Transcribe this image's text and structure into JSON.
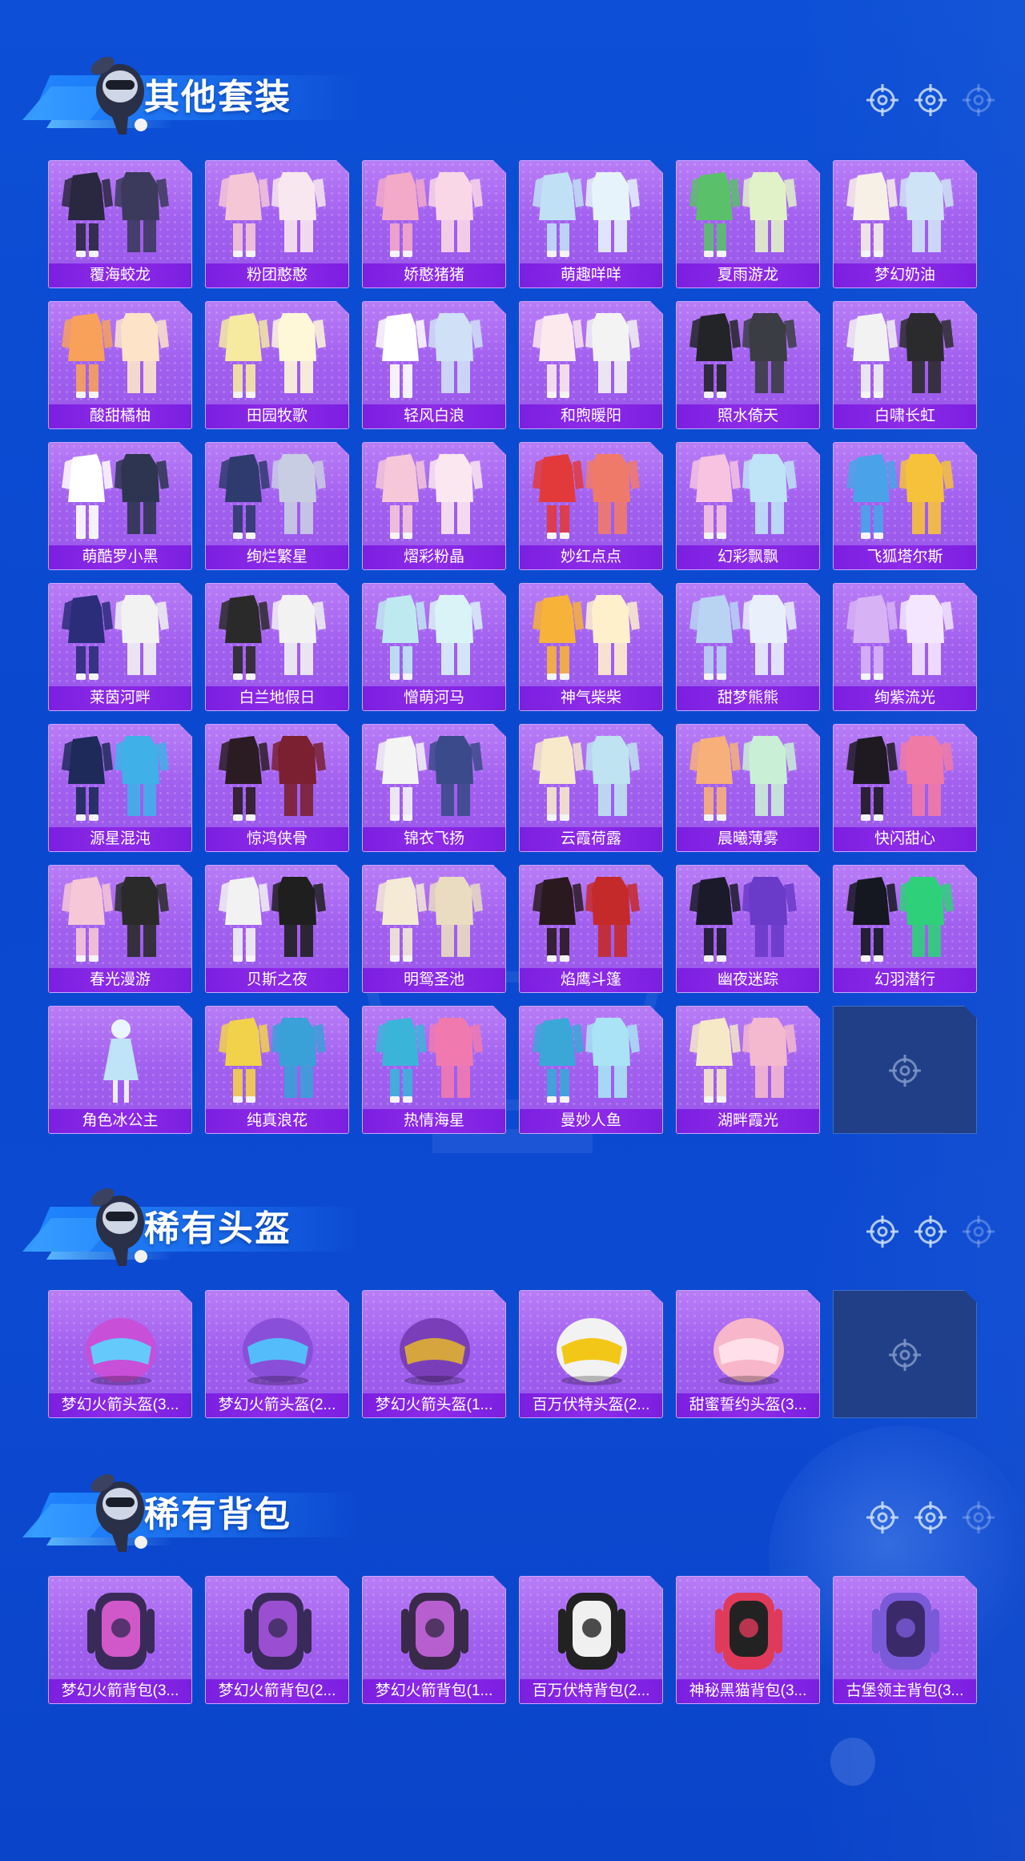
{
  "sections": [
    {
      "title": "其他套装",
      "items": [
        {
          "label": "覆海蛟龙",
          "icon": "outfit-icon",
          "palette": [
            "#2a2740",
            "#3b3a5c"
          ]
        },
        {
          "label": "粉团憨憨",
          "icon": "outfit-icon",
          "palette": [
            "#f5c6d6",
            "#f8e7ee"
          ]
        },
        {
          "label": "娇憨猪猪",
          "icon": "outfit-icon",
          "palette": [
            "#f3a9c8",
            "#f9d7e6"
          ]
        },
        {
          "label": "萌趣咩咩",
          "icon": "outfit-icon",
          "palette": [
            "#bfe0f5",
            "#e6f3fb"
          ]
        },
        {
          "label": "夏雨游龙",
          "icon": "outfit-icon",
          "palette": [
            "#5bc06a",
            "#e2f2c8"
          ]
        },
        {
          "label": "梦幻奶油",
          "icon": "outfit-icon",
          "palette": [
            "#f7f0e6",
            "#cfe3f6"
          ]
        },
        {
          "label": "酸甜橘柚",
          "icon": "outfit-icon",
          "palette": [
            "#f7a15a",
            "#fde4c9"
          ]
        },
        {
          "label": "田园牧歌",
          "icon": "outfit-icon",
          "palette": [
            "#f5eaa0",
            "#fff8d8"
          ]
        },
        {
          "label": "轻风白浪",
          "icon": "outfit-icon",
          "palette": [
            "#ffffff",
            "#cfe0f7"
          ]
        },
        {
          "label": "和煦暖阳",
          "icon": "outfit-icon",
          "palette": [
            "#fbe9ee",
            "#f3f3f3"
          ]
        },
        {
          "label": "照水倚天",
          "icon": "outfit-icon",
          "palette": [
            "#222428",
            "#3a3d44"
          ]
        },
        {
          "label": "白啸长虹",
          "icon": "outfit-icon",
          "palette": [
            "#f2f2f2",
            "#2b2b2e"
          ]
        },
        {
          "label": "萌酷罗小黑",
          "icon": "outfit-icon",
          "palette": [
            "#ffffff",
            "#2d3550"
          ]
        },
        {
          "label": "绚烂繁星",
          "icon": "outfit-icon",
          "palette": [
            "#2f3a6e",
            "#c9cde3"
          ]
        },
        {
          "label": "熠彩粉晶",
          "icon": "outfit-icon",
          "palette": [
            "#f6c7d8",
            "#fbe7ef"
          ]
        },
        {
          "label": "妙红点点",
          "icon": "outfit-icon",
          "palette": [
            "#e23a3a",
            "#f07a6a"
          ]
        },
        {
          "label": "幻彩飘飘",
          "icon": "outfit-icon",
          "palette": [
            "#f7c3e0",
            "#bfe3f7"
          ]
        },
        {
          "label": "飞狐塔尔斯",
          "icon": "outfit-icon",
          "palette": [
            "#4aa3e8",
            "#f6c23b"
          ]
        },
        {
          "label": "莱茵河畔",
          "icon": "outfit-icon",
          "palette": [
            "#2b2d7a",
            "#f2f2f2"
          ]
        },
        {
          "label": "白兰地假日",
          "icon": "outfit-icon",
          "palette": [
            "#2a2a2a",
            "#f2f2f2"
          ]
        },
        {
          "label": "憎萌河马",
          "icon": "outfit-icon",
          "palette": [
            "#bfe9f1",
            "#d9f3f7"
          ]
        },
        {
          "label": "神气柴柴",
          "icon": "outfit-icon",
          "palette": [
            "#f7b23a",
            "#fff0cc"
          ]
        },
        {
          "label": "甜梦熊熊",
          "icon": "outfit-icon",
          "palette": [
            "#b9d3f3",
            "#e9f0fb"
          ]
        },
        {
          "label": "绚紫流光",
          "icon": "outfit-icon",
          "palette": [
            "#d7b3f5",
            "#f5e6ff"
          ]
        },
        {
          "label": "源星混沌",
          "icon": "outfit-icon",
          "palette": [
            "#1e2a5a",
            "#3fb0e8"
          ]
        },
        {
          "label": "惊鸿侠骨",
          "icon": "outfit-icon",
          "palette": [
            "#2b1c24",
            "#7a2030"
          ]
        },
        {
          "label": "锦衣飞扬",
          "icon": "outfit-icon",
          "palette": [
            "#f4f4f4",
            "#3b4a8a"
          ]
        },
        {
          "label": "云霞荷露",
          "icon": "outfit-icon",
          "palette": [
            "#f7e9c9",
            "#bfe3f0"
          ]
        },
        {
          "label": "晨曦薄雾",
          "icon": "outfit-icon",
          "palette": [
            "#f7b07a",
            "#c9f0d6"
          ]
        },
        {
          "label": "快闪甜心",
          "icon": "outfit-icon",
          "palette": [
            "#1f1a22",
            "#f07aa6"
          ]
        },
        {
          "label": "春光漫游",
          "icon": "outfit-icon",
          "palette": [
            "#f6c7d6",
            "#2a2a2a"
          ]
        },
        {
          "label": "贝斯之夜",
          "icon": "outfit-icon",
          "palette": [
            "#f2f2f2",
            "#1f1f1f"
          ]
        },
        {
          "label": "明鸳圣池",
          "icon": "outfit-icon",
          "palette": [
            "#f4ead5",
            "#e9dcc0"
          ]
        },
        {
          "label": "焰鹰斗篷",
          "icon": "outfit-icon",
          "palette": [
            "#2a1a1f",
            "#c42a2a"
          ]
        },
        {
          "label": "幽夜迷踪",
          "icon": "outfit-icon",
          "palette": [
            "#1b1a2a",
            "#6a3ac9"
          ]
        },
        {
          "label": "幻羽潜行",
          "icon": "outfit-icon",
          "palette": [
            "#151820",
            "#2fd07a"
          ]
        },
        {
          "label": "角色冰公主",
          "icon": "character-icon",
          "palette": [
            "#bfe3f7",
            "#e9f6ff"
          ]
        },
        {
          "label": "纯真浪花",
          "icon": "outfit-icon",
          "palette": [
            "#f2d24a",
            "#3aa0d8"
          ]
        },
        {
          "label": "热情海星",
          "icon": "outfit-icon",
          "palette": [
            "#3ab5d9",
            "#f07ab0"
          ]
        },
        {
          "label": "曼妙人鱼",
          "icon": "outfit-icon",
          "palette": [
            "#3aa7d8",
            "#a9e3f5"
          ]
        },
        {
          "label": "湖畔霞光",
          "icon": "outfit-icon",
          "palette": [
            "#f6e9c7",
            "#f4b8cf"
          ]
        },
        {
          "label": "",
          "icon": "empty-slot",
          "palette": []
        }
      ]
    },
    {
      "title": "稀有头盔",
      "items": [
        {
          "label": "梦幻火箭头盔(3...",
          "icon": "helmet-icon",
          "palette": [
            "#c84fd8",
            "#5ad7ff"
          ]
        },
        {
          "label": "梦幻火箭头盔(2...",
          "icon": "helmet-icon",
          "palette": [
            "#8a4fd8",
            "#4fc8ff"
          ]
        },
        {
          "label": "梦幻火箭头盔(1...",
          "icon": "helmet-icon",
          "palette": [
            "#7a3fb8",
            "#e0b030"
          ]
        },
        {
          "label": "百万伏特头盔(2...",
          "icon": "helmet-icon",
          "palette": [
            "#f2f2f2",
            "#f2c200"
          ]
        },
        {
          "label": "甜蜜誓约头盔(3...",
          "icon": "helmet-icon",
          "palette": [
            "#f7b6c9",
            "#ffe3ec"
          ]
        },
        {
          "label": "",
          "icon": "empty-slot",
          "palette": []
        }
      ]
    },
    {
      "title": "稀有背包",
      "items": [
        {
          "label": "梦幻火箭背包(3...",
          "icon": "backpack-icon",
          "palette": [
            "#d058c8",
            "#3a2a5a"
          ]
        },
        {
          "label": "梦幻火箭背包(2...",
          "icon": "backpack-icon",
          "palette": [
            "#9a4fd0",
            "#3a2a5a"
          ]
        },
        {
          "label": "梦幻火箭背包(1...",
          "icon": "backpack-icon",
          "palette": [
            "#b85fd0",
            "#3a2a4a"
          ]
        },
        {
          "label": "百万伏特背包(2...",
          "icon": "backpack-icon",
          "palette": [
            "#f0f0f0",
            "#222222"
          ]
        },
        {
          "label": "神秘黑猫背包(3...",
          "icon": "backpack-icon",
          "palette": [
            "#222222",
            "#e03a5a"
          ]
        },
        {
          "label": "古堡领主背包(3...",
          "icon": "backpack-icon",
          "palette": [
            "#3a2a6a",
            "#7a5ad8"
          ]
        }
      ]
    }
  ]
}
